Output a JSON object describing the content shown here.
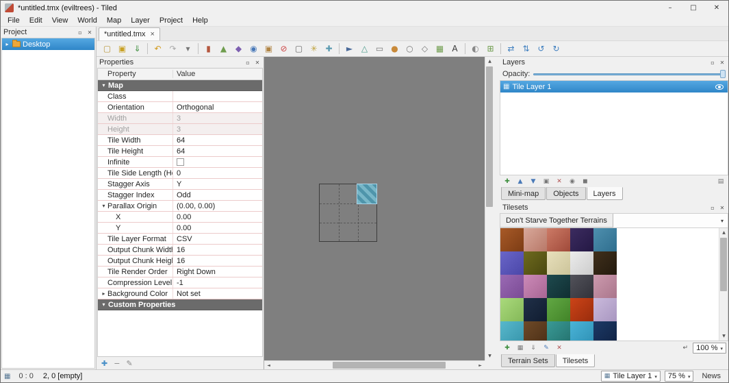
{
  "titlebar": {
    "title": "*untitled.tmx (eviltrees) - Tiled",
    "controls": [
      {
        "name": "minimize",
        "glyph": "–"
      },
      {
        "name": "maximize",
        "glyph": "□"
      },
      {
        "name": "close",
        "glyph": "✕"
      }
    ]
  },
  "menubar": [
    "File",
    "Edit",
    "View",
    "World",
    "Map",
    "Layer",
    "Project",
    "Help"
  ],
  "dock_icons": [
    {
      "name": "float-panel-icon",
      "glyph": "▫"
    },
    {
      "name": "close-panel-icon",
      "glyph": "✕"
    }
  ],
  "project_panel": {
    "title": "Project",
    "items": [
      {
        "label": "Desktop",
        "selected": true,
        "expander": "▸"
      }
    ]
  },
  "document_tabs": [
    {
      "label": "*untitled.tmx",
      "close": "×",
      "active": true
    }
  ],
  "main_toolbar": [
    {
      "name": "new-map-icon",
      "glyph": "▢",
      "c": "#b8963a"
    },
    {
      "name": "open-file-icon",
      "glyph": "▣",
      "c": "#c9a227"
    },
    {
      "name": "save-icon",
      "glyph": "⇓",
      "c": "#3f8f3f"
    },
    {
      "sep": true
    },
    {
      "name": "undo-icon",
      "glyph": "↶",
      "c": "#d29b1e"
    },
    {
      "name": "redo-icon",
      "glyph": "↷",
      "c": "#a9a9a9"
    },
    {
      "name": "history-dropdown-icon",
      "glyph": "▾",
      "c": "#777777"
    },
    {
      "sep": true
    },
    {
      "name": "stamp-brush-icon",
      "glyph": "▮",
      "c": "#b5563e"
    },
    {
      "name": "terrain-brush-icon",
      "glyph": "▲",
      "c": "#6f9d4e"
    },
    {
      "name": "wang-brush-icon",
      "glyph": "◆",
      "c": "#7d5fb0"
    },
    {
      "name": "bucket-fill-icon",
      "glyph": "◉",
      "c": "#4878b8"
    },
    {
      "name": "shape-fill-icon",
      "glyph": "▣",
      "c": "#b08444"
    },
    {
      "name": "eraser-icon",
      "glyph": "⊘",
      "c": "#cc4444"
    },
    {
      "name": "rect-select-icon",
      "glyph": "▢",
      "c": "#666666"
    },
    {
      "name": "magic-wand-icon",
      "glyph": "✳",
      "c": "#bfa23a"
    },
    {
      "name": "same-tile-select-icon",
      "glyph": "✚",
      "c": "#5a9ab0"
    },
    {
      "sep": true
    },
    {
      "name": "select-objects-icon",
      "glyph": "►",
      "c": "#4a6a9a"
    },
    {
      "name": "edit-polygons-icon",
      "glyph": "△",
      "c": "#4a9a8a"
    },
    {
      "name": "insert-rectangle-icon",
      "glyph": "▭",
      "c": "#777777"
    },
    {
      "name": "insert-point-icon",
      "glyph": "●",
      "c": "#c98a3a"
    },
    {
      "name": "insert-ellipse-icon",
      "glyph": "○",
      "c": "#777777"
    },
    {
      "name": "insert-polygon-icon",
      "glyph": "◇",
      "c": "#777777"
    },
    {
      "name": "insert-tile-icon",
      "glyph": "▦",
      "c": "#6f9d4e"
    },
    {
      "name": "insert-text-icon",
      "glyph": "A",
      "c": "#333333"
    },
    {
      "sep": true
    },
    {
      "name": "highlight-current-layer-icon",
      "glyph": "◐",
      "c": "#888888"
    },
    {
      "name": "snap-to-grid-icon",
      "glyph": "⊞",
      "c": "#6f9d4e"
    },
    {
      "sep": true
    },
    {
      "name": "flip-horizontal-icon",
      "glyph": "⇄",
      "c": "#3f7fbf"
    },
    {
      "name": "flip-vertical-icon",
      "glyph": "⇅",
      "c": "#3f7fbf"
    },
    {
      "name": "rotate-left-icon",
      "glyph": "↺",
      "c": "#3f7fbf"
    },
    {
      "name": "rotate-right-icon",
      "glyph": "↻",
      "c": "#3f7fbf"
    }
  ],
  "properties_panel": {
    "title": "Properties",
    "header": {
      "property": "Property",
      "value": "Value"
    },
    "rows": [
      {
        "kind": "group",
        "label": "Map",
        "expander": "▾"
      },
      {
        "label": "Class",
        "value": ""
      },
      {
        "label": "Orientation",
        "value": "Orthogonal"
      },
      {
        "label": "Width",
        "value": "3",
        "disabled": true
      },
      {
        "label": "Height",
        "value": "3",
        "disabled": true
      },
      {
        "label": "Tile Width",
        "value": "64"
      },
      {
        "label": "Tile Height",
        "value": "64"
      },
      {
        "label": "Infinite",
        "value": "",
        "checkbox": true
      },
      {
        "label": "Tile Side Length (Hex)",
        "value": "0"
      },
      {
        "label": "Stagger Axis",
        "value": "Y"
      },
      {
        "label": "Stagger Index",
        "value": "Odd"
      },
      {
        "label": "Parallax Origin",
        "value": "(0.00, 0.00)",
        "expander": "▾"
      },
      {
        "label": "X",
        "value": "0.00",
        "indent": true
      },
      {
        "label": "Y",
        "value": "0.00",
        "indent": true
      },
      {
        "label": "Tile Layer Format",
        "value": "CSV"
      },
      {
        "label": "Output Chunk Width",
        "value": "16"
      },
      {
        "label": "Output Chunk Height",
        "value": "16"
      },
      {
        "label": "Tile Render Order",
        "value": "Right Down"
      },
      {
        "label": "Compression Level",
        "value": "-1"
      },
      {
        "label": "Background Color",
        "value": "Not set",
        "expander": "▸"
      },
      {
        "kind": "group",
        "label": "Custom Properties",
        "expander": "▾"
      }
    ],
    "footer_icons": [
      {
        "name": "add-property-icon",
        "glyph": "✚",
        "c": "#4a90c8"
      },
      {
        "name": "remove-property-icon",
        "glyph": "−",
        "c": "#888888"
      },
      {
        "name": "edit-property-icon",
        "glyph": "✎",
        "c": "#888888"
      }
    ]
  },
  "canvas": {
    "grid": {
      "columns": 3,
      "rows": 3
    },
    "placed_tile": {
      "row": 0,
      "col": 2,
      "color1": "#79b7c8",
      "color2": "#4f95ab"
    }
  },
  "layers_panel": {
    "title": "Layers",
    "opacity_label": "Opacity:",
    "layers": [
      {
        "name": "Tile Layer 1",
        "selected": true,
        "visible": true,
        "icon": "▦"
      }
    ],
    "toolbar": [
      {
        "name": "new-layer-icon",
        "glyph": "✚",
        "c": "#3f8f3f"
      },
      {
        "name": "raise-layer-icon",
        "glyph": "▲",
        "c": "#4a7ab8"
      },
      {
        "name": "lower-layer-icon",
        "glyph": "▼",
        "c": "#4a7ab8"
      },
      {
        "name": "duplicate-layer-icon",
        "glyph": "▣",
        "c": "#777777"
      },
      {
        "name": "remove-layer-icon",
        "glyph": "✕",
        "c": "#b05050"
      },
      {
        "name": "show-hide-other-layers-icon",
        "glyph": "◉",
        "c": "#777777"
      },
      {
        "name": "lock-layer-icon",
        "glyph": "◼",
        "c": "#777777"
      }
    ],
    "toolbar_right": [
      {
        "name": "highlight-layer-toggle-icon",
        "glyph": "▤",
        "c": "#777777"
      }
    ],
    "tabs": [
      {
        "label": "Mini-map"
      },
      {
        "label": "Objects"
      },
      {
        "label": "Layers",
        "active": true
      }
    ]
  },
  "tilesets_panel": {
    "title": "Tilesets",
    "tileset_name": "Don't Starve Together Terrains",
    "tiles": [
      [
        "#a85a28",
        "#7c3c14"
      ],
      [
        "#d8a89a",
        "#b87868"
      ],
      [
        "#cc7a66",
        "#a04a3a"
      ],
      [
        "#3c2c60",
        "#241844"
      ],
      [
        "#4e8fae",
        "#2f6e8e"
      ],
      [
        "#6a66c8",
        "#4a46a8"
      ],
      [
        "#6e6a1e",
        "#4a4810"
      ],
      [
        "#e8e0bc",
        "#ccc49a"
      ],
      [
        "#ececec",
        "#cccccc"
      ],
      [
        "#40301c",
        "#241a0e"
      ],
      [
        "#9a6ab4",
        "#7a4a94"
      ],
      [
        "#cc8ab8",
        "#a86694"
      ],
      [
        "#1e4a4e",
        "#102e32"
      ],
      [
        "#52525a",
        "#32323a"
      ],
      [
        "#cc9aae",
        "#aa768c"
      ],
      [
        "#aada7c",
        "#84b858"
      ],
      [
        "#203048",
        "#101c30"
      ],
      [
        "#62a844",
        "#428428"
      ],
      [
        "#cc4418",
        "#992c0c"
      ],
      [
        "#cabadc",
        "#a896c0"
      ],
      [
        "#58b8cc",
        "#3694aa"
      ],
      [
        "#6e4a28",
        "#4c2f16"
      ],
      [
        "#3a9a96",
        "#24726e"
      ],
      [
        "#4ab4d8",
        "#2e90b4"
      ],
      [
        "#1c3a66",
        "#102244"
      ]
    ],
    "toolbar": [
      {
        "name": "new-tileset-icon",
        "glyph": "✚",
        "c": "#3f8f3f"
      },
      {
        "name": "embed-tileset-icon",
        "glyph": "▦",
        "c": "#777777"
      },
      {
        "name": "export-tileset-icon",
        "glyph": "⇓",
        "c": "#777777"
      },
      {
        "name": "edit-tileset-icon",
        "glyph": "✎",
        "c": "#4a7ab8"
      },
      {
        "name": "remove-tileset-icon",
        "glyph": "✕",
        "c": "#b05050"
      }
    ],
    "wrap_icon": {
      "name": "dynamic-wrap-icon",
      "glyph": "↵",
      "c": "#555555"
    },
    "zoom": "100 %",
    "tabs": [
      {
        "label": "Terrain Sets"
      },
      {
        "label": "Tilesets",
        "active": true
      }
    ]
  },
  "statusbar": {
    "left_icon": "▦",
    "hover_info": "0 : 0",
    "cursor_info": "2, 0 [empty]",
    "layer_icon": "▦",
    "layer_combo": "Tile Layer 1",
    "zoom_combo": "75 %",
    "news": "News"
  }
}
